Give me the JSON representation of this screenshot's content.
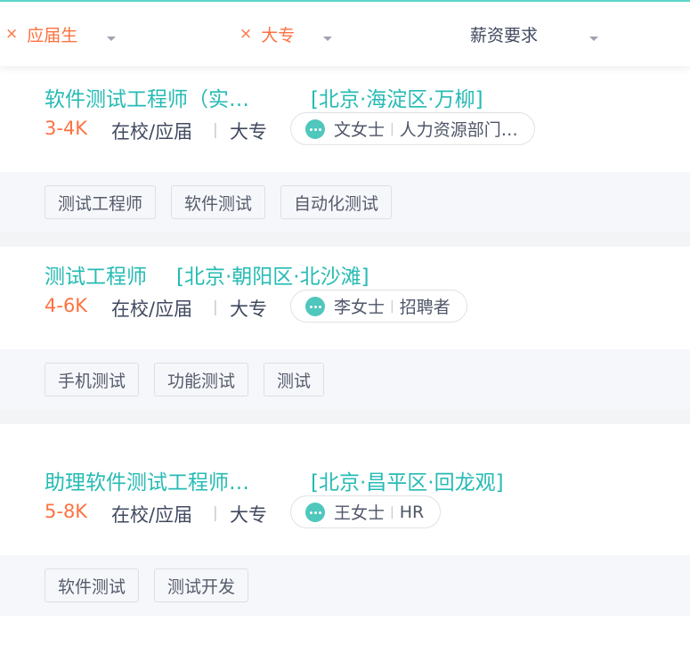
{
  "filters": [
    {
      "label": "应届生",
      "clear_icon": "×",
      "selected": true
    },
    {
      "label": "大专",
      "clear_icon": "×",
      "selected": true
    },
    {
      "label": "薪资要求",
      "selected": false
    }
  ],
  "jobs": [
    {
      "title": "软件测试工程师（实…",
      "location": "[北京·海淀区·万柳]",
      "salary": "3-4K",
      "experience": "在校/应届",
      "education": "大专",
      "contact_name": "文女士",
      "contact_role": "人力资源部门…",
      "tags": [
        "测试工程师",
        "软件测试",
        "自动化测试"
      ]
    },
    {
      "title": "测试工程师",
      "location": "[北京·朝阳区·北沙滩]",
      "salary": "4-6K",
      "experience": "在校/应届",
      "education": "大专",
      "contact_name": "李女士",
      "contact_role": "招聘者",
      "tags": [
        "手机测试",
        "功能测试",
        "测试"
      ]
    },
    {
      "title": "助理软件测试工程师…",
      "location": "[北京·昌平区·回龙观]",
      "salary": "5-8K",
      "experience": "在校/应届",
      "education": "大专",
      "contact_name": "王女士",
      "contact_role": "HR",
      "tags": [
        "软件测试",
        "测试开发"
      ]
    }
  ],
  "separator": "|",
  "colors": {
    "accent": "#26bbb4",
    "salary": "#fd7240",
    "text": "#414a60"
  }
}
